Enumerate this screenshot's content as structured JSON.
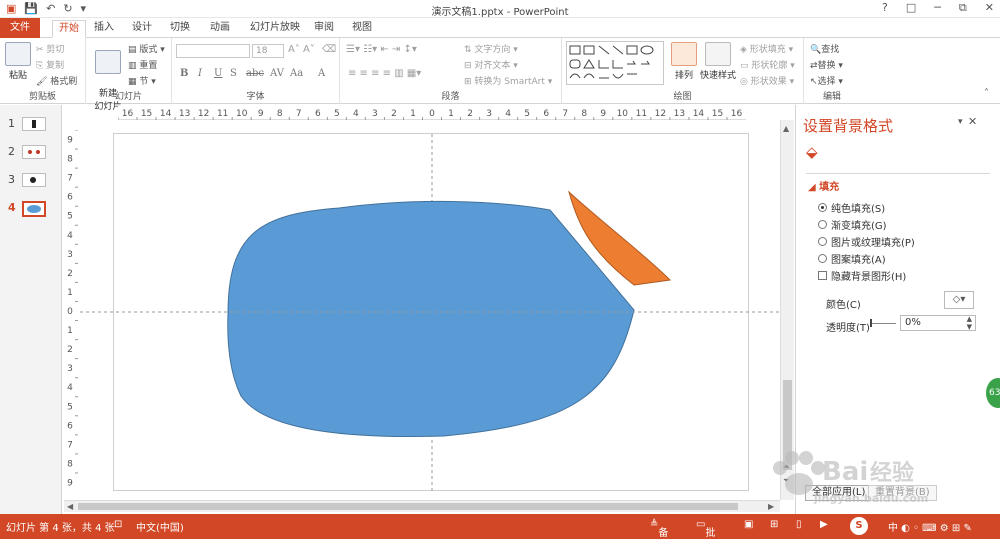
{
  "window": {
    "title": "演示文稿1.pptx - PowerPoint",
    "help": "?",
    "controls": [
      "□",
      "─",
      "⧉",
      "✕"
    ]
  },
  "tabs": [
    "文件",
    "开始",
    "插入",
    "设计",
    "切换",
    "动画",
    "幻灯片放映",
    "审阅",
    "视图"
  ],
  "ribbon": {
    "clipboard": {
      "paste": "粘贴",
      "cut": "剪切",
      "copy": "复制",
      "format_painter": "格式刷",
      "label": "剪贴板"
    },
    "slides": {
      "new_slide": "新建\n幻灯片",
      "layout": "版式",
      "reset": "重置",
      "section": "节",
      "label": "幻灯片"
    },
    "font": {
      "font_size": "18",
      "label": "字体",
      "bold": "B",
      "italic": "I",
      "underline": "U",
      "strike": "S",
      "shadow": "abc",
      "spacing": "AV",
      "case": "Aa",
      "color": "A"
    },
    "paragraph": {
      "text_direction": "文字方向",
      "align_text": "对齐文本",
      "smartart": "转换为 SmartArt",
      "label": "段落"
    },
    "drawing": {
      "arrange": "排列",
      "quick_styles": "快速样式",
      "shape_fill": "形状填充",
      "shape_outline": "形状轮廓",
      "shape_effects": "形状效果",
      "label": "绘图"
    },
    "editing": {
      "find": "查找",
      "replace": "替换",
      "select": "选择",
      "label": "编辑"
    }
  },
  "thumbnails": [
    {
      "num": "1",
      "selected": false
    },
    {
      "num": "2",
      "selected": false
    },
    {
      "num": "3",
      "selected": false
    },
    {
      "num": "4",
      "selected": true
    }
  ],
  "ruler": {
    "h_ticks": [
      "16",
      "15",
      "14",
      "13",
      "12",
      "11",
      "10",
      "9",
      "8",
      "7",
      "6",
      "5",
      "4",
      "3",
      "2",
      "1",
      "0",
      "1",
      "2",
      "3",
      "4",
      "5",
      "6",
      "7",
      "8",
      "9",
      "10",
      "11",
      "12",
      "13",
      "14",
      "15",
      "16"
    ],
    "v_ticks": [
      "9",
      "8",
      "7",
      "6",
      "5",
      "4",
      "3",
      "2",
      "1",
      "0",
      "1",
      "2",
      "3",
      "4",
      "5",
      "6",
      "7",
      "8",
      "9"
    ]
  },
  "format_pane": {
    "title": "设置背景格式",
    "section": "填充",
    "options": [
      "纯色填充(S)",
      "渐变填充(G)",
      "图片或纹理填充(P)",
      "图案填充(A)"
    ],
    "hide_graphics": "隐藏背景图形(H)",
    "color_label": "颜色(C)",
    "transparency_label": "透明度(T)",
    "transparency_value": "0%",
    "apply_all": "全部应用(L)",
    "reset_bg": "重置背景(B)"
  },
  "status": {
    "slide_info": "幻灯片 第 4 张，共 4 张",
    "language": "中文(中国)",
    "notes": "备注",
    "comments": "批注",
    "badge": "63"
  },
  "colors": {
    "accent": "#d24726",
    "blue_shape": "#5b9bd5",
    "orange_shape": "#ed7d31"
  },
  "watermark": "Baidu经验"
}
